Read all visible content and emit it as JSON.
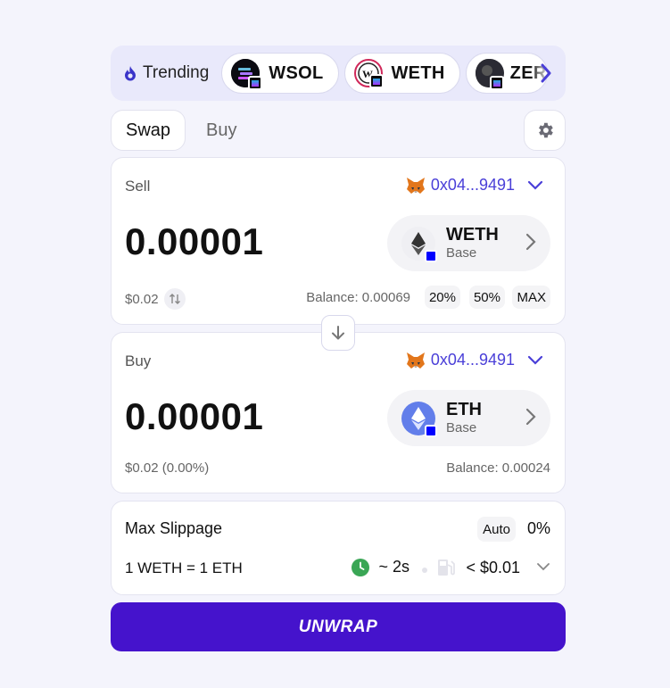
{
  "trending": {
    "label": "Trending",
    "tokens": [
      {
        "symbol": "WSOL"
      },
      {
        "symbol": "WETH"
      },
      {
        "symbol": "ZER"
      }
    ]
  },
  "tabs": [
    {
      "label": "Swap"
    },
    {
      "label": "Buy"
    }
  ],
  "sell": {
    "label": "Sell",
    "wallet": "0x04...9491",
    "amount": "0.00001",
    "token": {
      "symbol": "WETH",
      "network": "Base"
    },
    "usd": "$0.02",
    "balance": "Balance: 0.00069",
    "percent_buttons": [
      "20%",
      "50%",
      "MAX"
    ]
  },
  "buy": {
    "label": "Buy",
    "wallet": "0x04...9491",
    "amount": "0.00001",
    "token": {
      "symbol": "ETH",
      "network": "Base"
    },
    "usd": "$0.02 (0.00%)",
    "balance": "Balance: 0.00024"
  },
  "info": {
    "slippage_label": "Max Slippage",
    "auto_label": "Auto",
    "slippage_value": "0%",
    "rate": "1 WETH = 1 ETH",
    "time": "~ 2s",
    "gas": "< $0.01"
  },
  "cta": {
    "label": "UNWRAP"
  },
  "colors": {
    "accent": "#4513cc",
    "wallet_text": "#4a3fd8",
    "page_bg": "#f4f4fc",
    "clock_green": "#3aa655"
  }
}
